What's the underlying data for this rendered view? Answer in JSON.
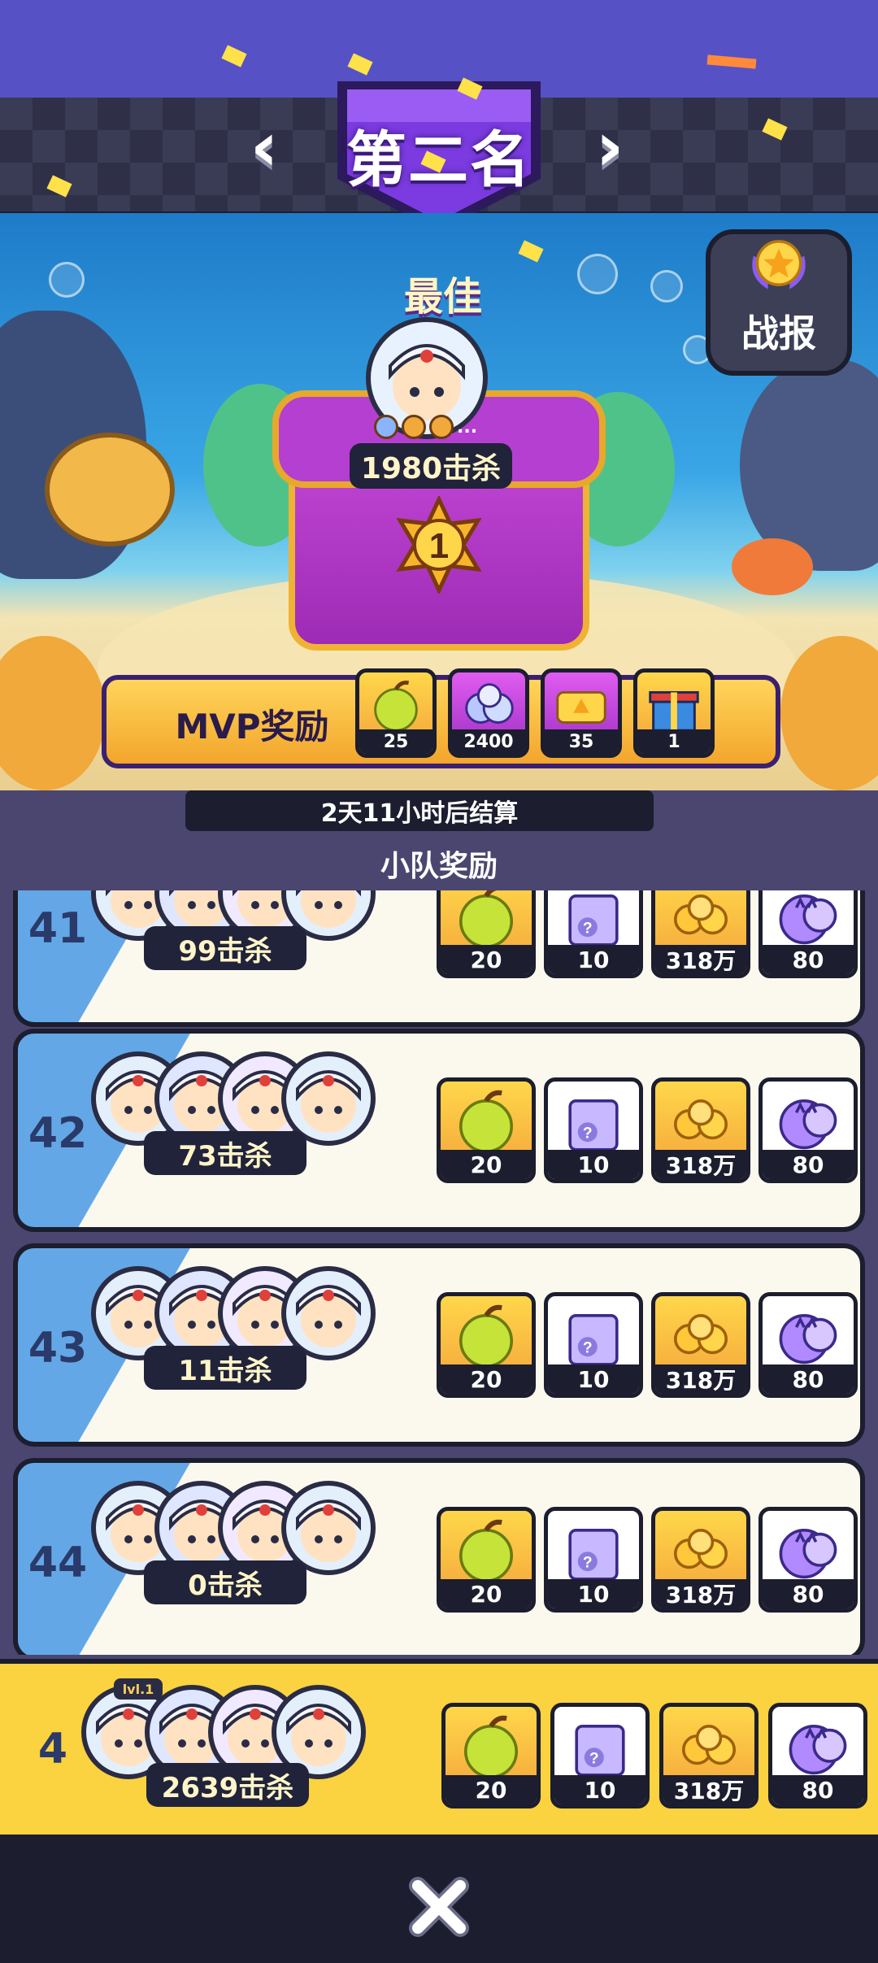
{
  "header": {
    "title": "第二名",
    "prev_icon": "chevron-left-icon",
    "next_icon": "chevron-right-icon"
  },
  "mvp": {
    "best_label": "最佳",
    "kills": "1980击杀",
    "rank_number": "1",
    "more_badges": "...",
    "reward_label": "MVP奖励",
    "rewards": [
      {
        "icon": "fruit-icon",
        "count": "25"
      },
      {
        "icon": "gem-orbs-icon",
        "count": "2400"
      },
      {
        "icon": "ticket-icon",
        "count": "35"
      },
      {
        "icon": "gift-box-icon",
        "count": "1"
      }
    ]
  },
  "battle_report": {
    "label": "战报",
    "icon": "trophy-star-icon"
  },
  "settlement": "2天11小时后结算",
  "team_reward_title": "小队奖励",
  "teams": [
    {
      "rank": "41",
      "kills": "99击杀",
      "rewards": [
        "20",
        "10",
        "318万",
        "80"
      ]
    },
    {
      "rank": "42",
      "kills": "73击杀",
      "rewards": [
        "20",
        "10",
        "318万",
        "80"
      ]
    },
    {
      "rank": "43",
      "kills": "11击杀",
      "rewards": [
        "20",
        "10",
        "318万",
        "80"
      ]
    },
    {
      "rank": "44",
      "kills": "0击杀",
      "rewards": [
        "20",
        "10",
        "318万",
        "80"
      ]
    }
  ],
  "my_team": {
    "rank": "4",
    "level": "lvl.1",
    "kills": "2639击杀",
    "rewards": [
      "20",
      "10",
      "318万",
      "80"
    ]
  },
  "reward_icons": [
    "fruit-icon",
    "mystery-box-icon",
    "gold-candy-icon",
    "cat-capsule-icon"
  ],
  "close_icon": "close-x-icon"
}
